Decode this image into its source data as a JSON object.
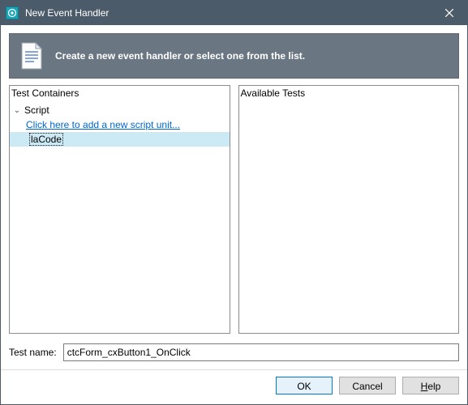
{
  "titlebar": {
    "title": "New Event Handler"
  },
  "banner": {
    "message": "Create a new event handler or select one from the list."
  },
  "panels": {
    "left": {
      "title": "Test Containers",
      "tree": {
        "root": "Script",
        "add_link": "Click here to add a new script unit...",
        "selected_item": "laCode"
      }
    },
    "right": {
      "title": "Available Tests"
    }
  },
  "test_name": {
    "label": "Test name:",
    "value": "ctcForm_cxButton1_OnClick"
  },
  "buttons": {
    "ok": "OK",
    "cancel": "Cancel",
    "help": "Help"
  }
}
